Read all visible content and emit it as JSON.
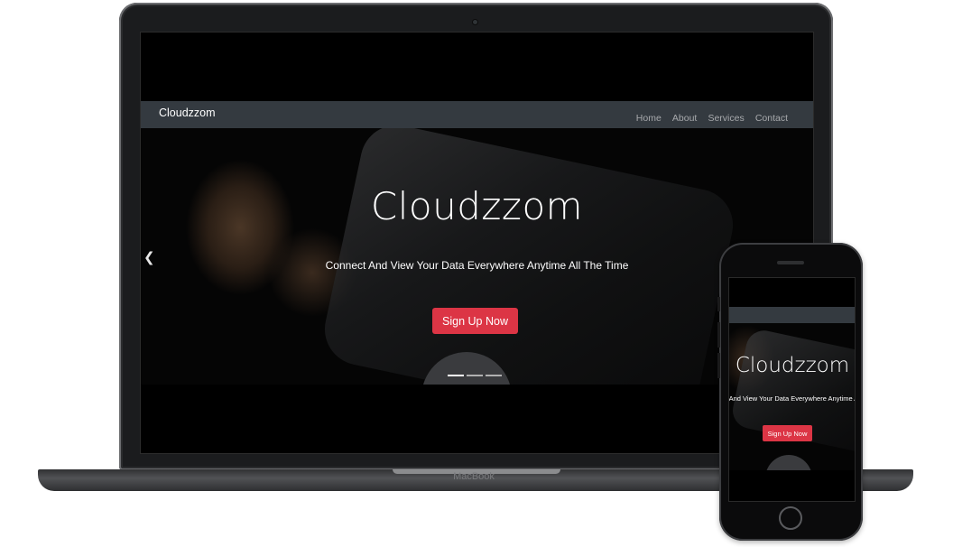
{
  "laptop": {
    "label": "MacBook"
  },
  "site": {
    "brand": "Cloudzzom",
    "nav": [
      "Home",
      "About",
      "Services",
      "Contact"
    ],
    "hero_title": "Cloudzzom",
    "hero_subtitle": "Connect And View Your Data Everywhere Anytime All The Time",
    "cta_label": "Sign Up Now",
    "prev_icon": "chevron-left-icon",
    "slides": 3,
    "active_slide": 1
  },
  "phone": {
    "hero_title": "Cloudzzom",
    "hero_subtitle": "Connect And View Your Data Everywhere Anytime All The Time",
    "cta_label": "Sign Up Now"
  },
  "colors": {
    "navbar": "#343a40",
    "cta": "#dc3545",
    "screen_bg": "#000000"
  }
}
